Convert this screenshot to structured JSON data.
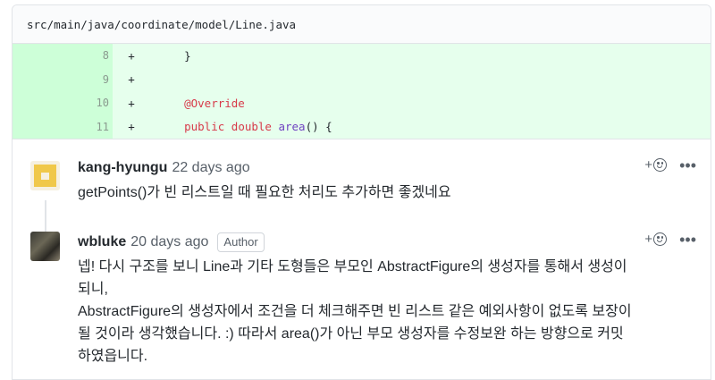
{
  "file": {
    "path": "src/main/java/coordinate/model/Line.java"
  },
  "diff": {
    "rows": [
      {
        "line": "8",
        "sign": "+",
        "code": "    }"
      },
      {
        "line": "9",
        "sign": "+",
        "code": ""
      },
      {
        "line": "10",
        "sign": "+",
        "code": "    @Override"
      },
      {
        "line": "11",
        "sign": "+",
        "code": "    public double area() {"
      }
    ]
  },
  "comments": [
    {
      "author": "kang-hyungu",
      "time": "22 days ago",
      "badge": "",
      "body": "getPoints()가 빈 리스트일 때 필요한 처리도 추가하면 좋겠네요"
    },
    {
      "author": "wbluke",
      "time": "20 days ago",
      "badge": "Author",
      "body_lines": [
        "넵! 다시 구조를 보니 Line과 기타 도형들은 부모인 AbstractFigure의 생성자를 통해서 생성이",
        "되니,",
        "AbstractFigure의 생성자에서 조건을 더 체크해주면 빈 리스트 같은 예외사항이 없도록 보장이",
        "될 것이라 생각했습니다. :) 따라서 area()가 아닌 부모 생성자를 수정보완 하는 방향으로 커밋",
        "하였읍니다."
      ]
    }
  ],
  "actions": {
    "react_label": "+",
    "more_label": "•••"
  }
}
